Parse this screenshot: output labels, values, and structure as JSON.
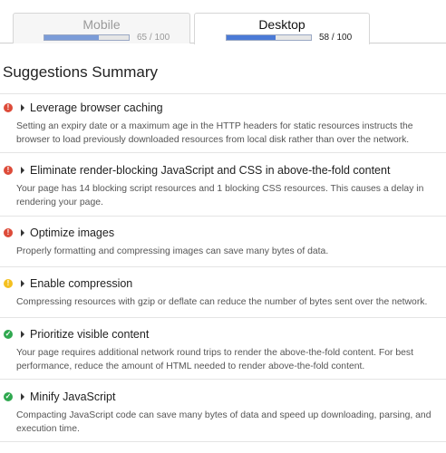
{
  "tabs": [
    {
      "label": "Mobile",
      "score": 65,
      "score_text": "65 / 100",
      "active": false
    },
    {
      "label": "Desktop",
      "score": 58,
      "score_text": "58 / 100",
      "active": true
    }
  ],
  "summary_title": "Suggestions Summary",
  "colors": {
    "error": "#dd4b39",
    "warning": "#f4c020",
    "passed": "#2fa84f"
  },
  "suggestions": [
    {
      "status": "error",
      "icon": "exclamation-icon",
      "title": "Leverage browser caching",
      "description": "Setting an expiry date or a maximum age in the HTTP headers for static resources instructs the browser to load previously downloaded resources from local disk rather than over the network."
    },
    {
      "status": "error",
      "icon": "exclamation-icon",
      "title": "Eliminate render-blocking JavaScript and CSS in above-the-fold content",
      "description": "Your page has 14 blocking script resources and 1 blocking CSS resources. This causes a delay in rendering your page."
    },
    {
      "status": "error",
      "icon": "exclamation-icon",
      "title": "Optimize images",
      "description": "Properly formatting and compressing images can save many bytes of data."
    },
    {
      "status": "warning",
      "icon": "exclamation-icon",
      "title": "Enable compression",
      "description": "Compressing resources with gzip or deflate can reduce the number of bytes sent over the network."
    },
    {
      "status": "passed",
      "icon": "check-icon",
      "title": "Prioritize visible content",
      "description": "Your page requires additional network round trips to render the above-the-fold content. For best performance, reduce the amount of HTML needed to render above-the-fold content."
    },
    {
      "status": "passed",
      "icon": "check-icon",
      "title": "Minify JavaScript",
      "description": "Compacting JavaScript code can save many bytes of data and speed up downloading, parsing, and execution time."
    }
  ]
}
